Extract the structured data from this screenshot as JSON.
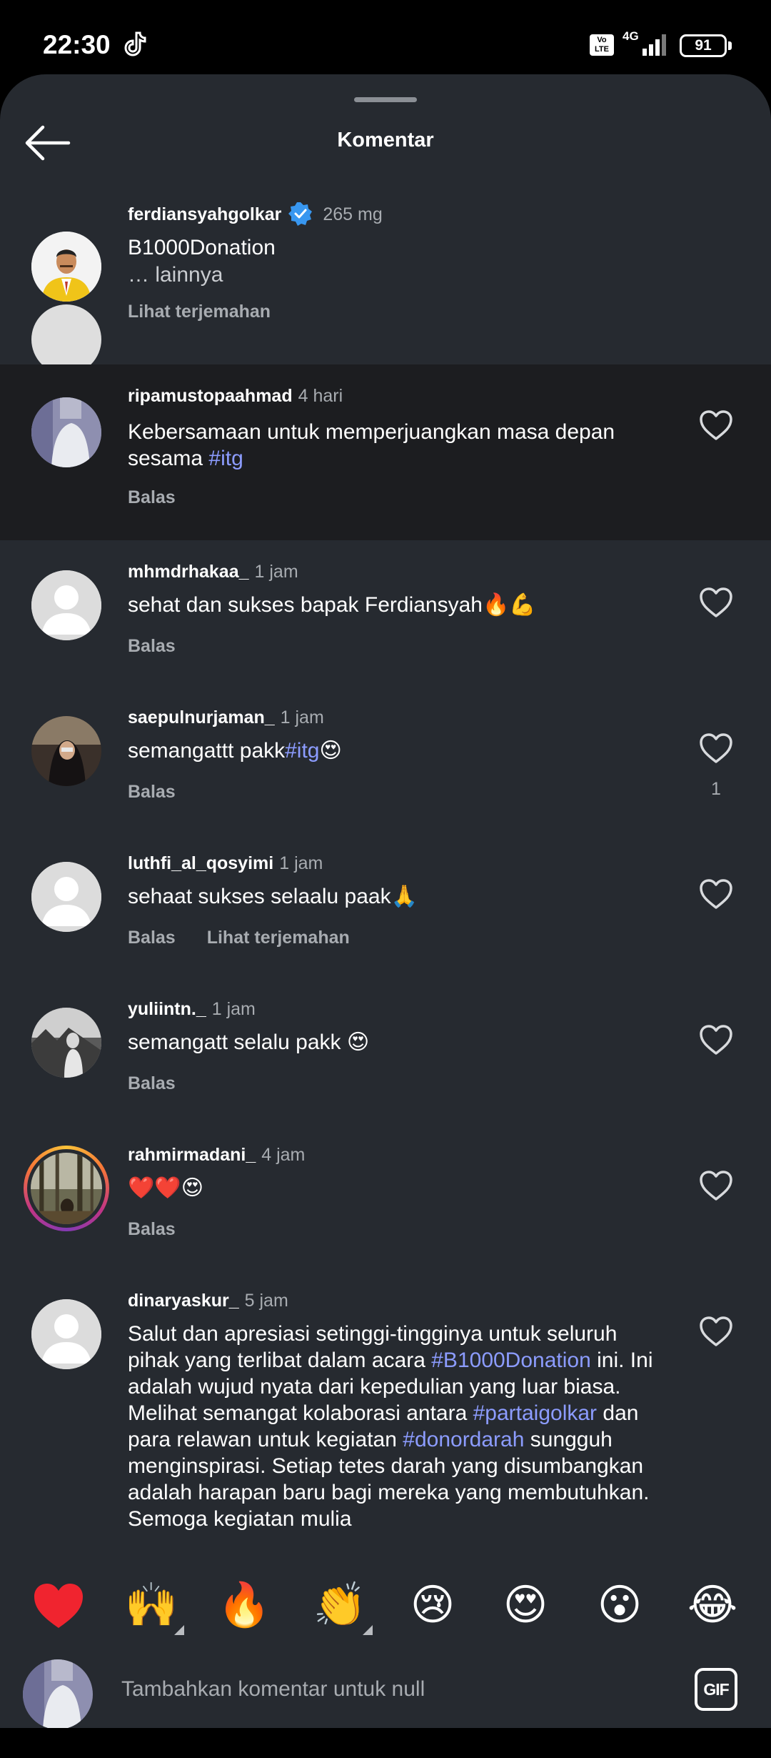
{
  "status_bar": {
    "time": "22:30",
    "volte": "Vo LTE",
    "network": "4G",
    "battery": "91"
  },
  "sheet": {
    "title": "Komentar"
  },
  "caption": {
    "username": "ferdiansyahgolkar",
    "time": "265 mg",
    "text": "B1000Donation",
    "more": "… lainnya",
    "translate": "Lihat terjemahan"
  },
  "comments": [
    {
      "username": "ripamustopaahmad",
      "time": "4 hari",
      "text_parts": [
        "Kebersamaan untuk memperjuangkan masa depan sesama ",
        "#itg"
      ],
      "reply": "Balas"
    },
    {
      "username": "mhmdrhakaa_",
      "time": "1 jam",
      "text": "sehat dan sukses bapak Ferdiansyah🔥💪",
      "reply": "Balas"
    },
    {
      "username": "saepulnurjaman_",
      "time": "1 jam",
      "text_parts": [
        "semangattt pakk",
        "#itg",
        "😍"
      ],
      "reply": "Balas",
      "likes": "1"
    },
    {
      "username": "luthfi_al_qosyimi",
      "time": "1 jam",
      "text": "sehaat sukses selaalu paak🙏",
      "reply": "Balas",
      "translate": "Lihat terjemahan"
    },
    {
      "username": "yuliintn._",
      "time": "1 jam",
      "text": "semangatt selalu pakk 😍",
      "reply": "Balas"
    },
    {
      "username": "rahmirmadani_",
      "time": "4 jam",
      "text": "❤️❤️😍",
      "reply": "Balas"
    },
    {
      "username": "dinaryaskur_",
      "time": "5 jam",
      "text_parts": [
        "Salut dan apresiasi setinggi-tingginya untuk seluruh pihak yang terlibat dalam acara ",
        "#B1000Donation",
        " ini. Ini adalah wujud nyata dari kepedulian yang luar biasa. Melihat semangat kolaborasi antara ",
        "#partaigolkar",
        " dan para relawan untuk kegiatan ",
        "#donordarah",
        " sungguh menginspirasi. Setiap tetes darah yang disumbangkan adalah harapan baru bagi mereka yang membutuhkan. Semoga kegiatan mulia"
      ]
    }
  ],
  "reactions": [
    "❤️",
    "🙌",
    "🔥",
    "👏",
    "😢",
    "😍",
    "😮",
    "😂"
  ],
  "composer": {
    "placeholder": "Tambahkan komentar untuk null",
    "gif_label": "GIF"
  },
  "colors": {
    "sheet_bg": "#262a30",
    "highlight_bg": "#1c1d20",
    "hashtag": "#8c9cff",
    "muted": "#a8acb1",
    "verified": "#3897f0"
  },
  "icons": [
    "back-arrow-icon",
    "verified-badge-icon",
    "heart-outline-icon",
    "gif-icon",
    "tiktok-icon",
    "signal-icon",
    "battery-icon",
    "default-avatar-icon"
  ]
}
